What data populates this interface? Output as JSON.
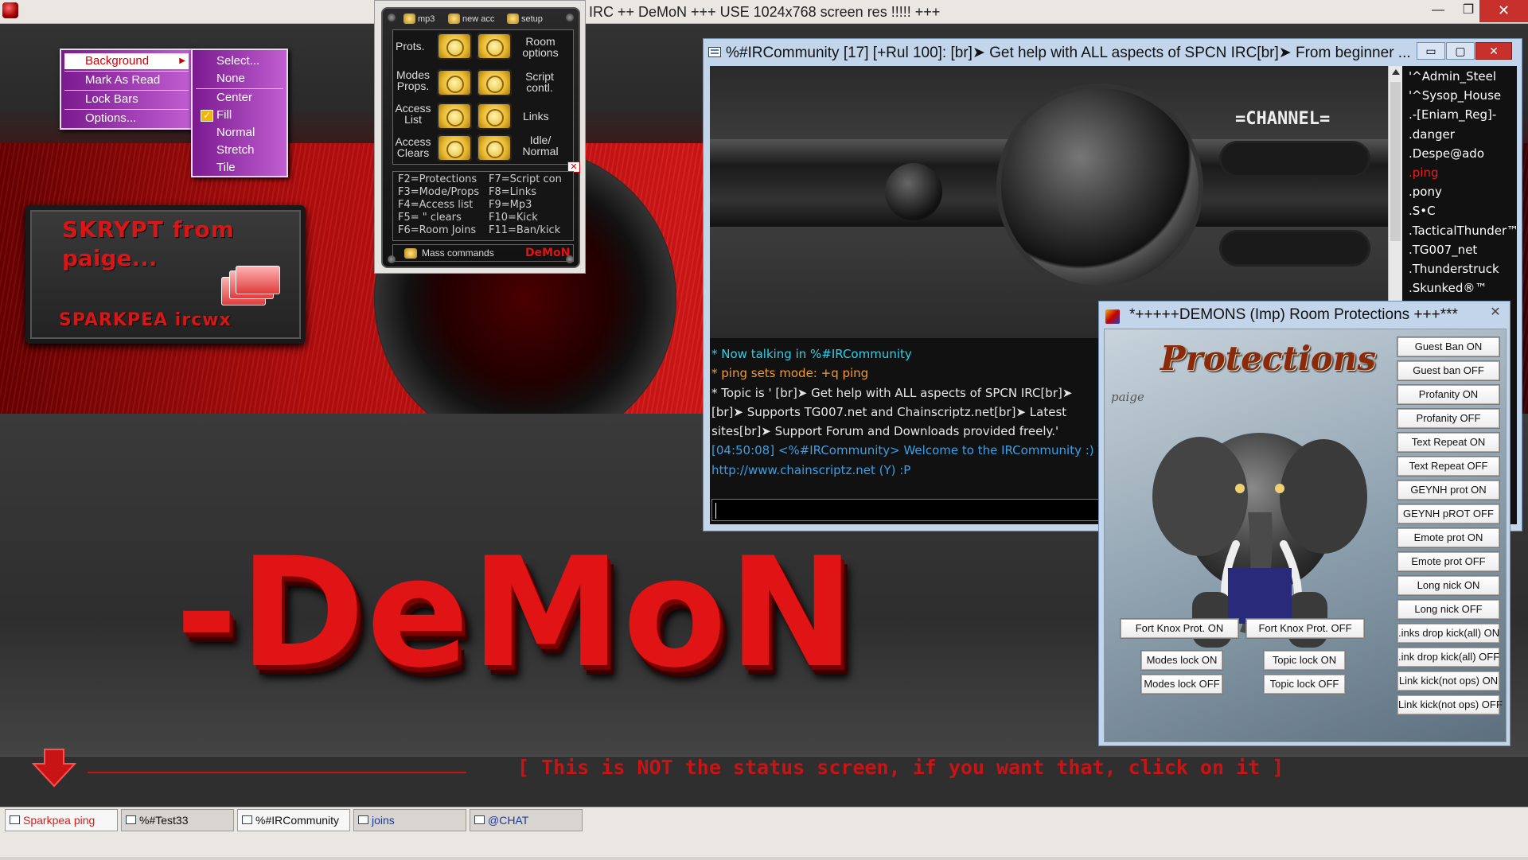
{
  "app": {
    "title": "IRC ++ DeMoN +++ USE 1024x768 screen res !!!!! +++",
    "controls": {
      "minimize": "—",
      "maximize": "❐",
      "close": "✕"
    }
  },
  "background": {
    "skrypt_line1": "SKRYPT from",
    "skrypt_line2": "paige...",
    "skrypt_line3": "SPARKPEA  ircwx",
    "big_logo": "-DeMoN",
    "status_notice": "[ This is NOT the status screen, if you want that, click on it ]",
    "accent_color": "#d81616"
  },
  "context_menu": {
    "items": [
      "Background",
      "Mark As Read",
      "Lock Bars",
      "Options..."
    ],
    "submenu": [
      "Select...",
      "None",
      "Center",
      "Fill",
      "Normal",
      "Stretch",
      "Tile"
    ],
    "checked": "Fill"
  },
  "control_panel": {
    "tabs": [
      "mp3",
      "new acc",
      "setup"
    ],
    "buttons": [
      {
        "label": "Prots."
      },
      {
        "label": "Room options"
      },
      {
        "label": "Modes Props."
      },
      {
        "label": "Script contl."
      },
      {
        "label": "Access List"
      },
      {
        "label": "Links"
      },
      {
        "label": "Access Clears"
      },
      {
        "label": "Idle/ Normal"
      }
    ],
    "keys_left": [
      "F2=Protections",
      "F3=Mode/Props",
      "F4=Access list",
      "F5= \" clears",
      "F6=Room Joins"
    ],
    "keys_right": [
      "F7=Script con",
      "F8=Links",
      "F9=Mp3",
      "F10=Kick",
      "F11=Ban/kick"
    ],
    "mass_label": "Mass commands",
    "brand": "DeMoN"
  },
  "channel": {
    "title": "%#IRCommunity [17] [+Rul 100]:  [br]➤ Get help with ALL aspects of SPCN IRC[br]➤ From beginner ...",
    "art_label": "=CHANNEL=",
    "lines": [
      {
        "text": "* Now talking in %#IRCommunity",
        "color": "#2fd0e8"
      },
      {
        "text": "* ping sets mode: +q ping",
        "color": "#f39a2a"
      },
      {
        "text": "* Topic is ' [br]➤ Get help with ALL aspects of SPCN IRC[br]➤",
        "color": "#e6e6e6"
      },
      {
        "text": "  [br]➤ Supports TG007.net and Chainscriptz.net[br]➤ Latest",
        "color": "#e6e6e6"
      },
      {
        "text": "  sites[br]➤ Support Forum and Downloads provided freely.'",
        "color": "#e6e6e6"
      },
      {
        "text": "[04:50:08] <%#IRCommunity> Welcome to the IRCommunity :) You",
        "color": "#3aa0e8"
      },
      {
        "text": "http://www.chainscriptz.net (Y) :P",
        "color": "#3aa0e8"
      }
    ],
    "nicks": [
      {
        "name": "'^Admin_Steel",
        "color": "#ffffff"
      },
      {
        "name": "'^Sysop_House",
        "color": "#ffffff"
      },
      {
        "name": ".-[Eniam_Reg]-",
        "color": "#ffffff"
      },
      {
        "name": ".danger",
        "color": "#ffffff"
      },
      {
        "name": ".Despe@ado",
        "color": "#ffffff"
      },
      {
        "name": ".ping",
        "color": "#e02020"
      },
      {
        "name": ".pony",
        "color": "#ffffff"
      },
      {
        "name": ".S•C",
        "color": "#ffffff"
      },
      {
        "name": ".TacticalThunder™",
        "color": "#ffffff"
      },
      {
        "name": ".TG007_net",
        "color": "#ffffff"
      },
      {
        "name": ".Thunderstruck",
        "color": "#ffffff"
      },
      {
        "name": ".Skunked®™",
        "color": "#ffffff"
      }
    ]
  },
  "protections": {
    "title": "*+++++DEMONS (Imp) Room Protections +++***",
    "heading": "Protections",
    "author": "paige",
    "right_buttons": [
      "Guest Ban ON",
      "Guest ban OFF",
      "Profanity ON",
      "Profanity OFF",
      "Text Repeat ON",
      "Text Repeat OFF",
      "GEYNH prot ON",
      "GEYNH pROT OFF",
      "Emote prot ON",
      "Emote prot OFF",
      "Long nick ON",
      "Long nick OFF",
      ".inks drop kick(all) ON",
      ".ink drop kick(all) OFF",
      "Link kick(not ops) ON",
      "Link kick(not ops) OFF"
    ],
    "fortknox_on": "Fort Knox Prot. ON",
    "fortknox_off": "Fort Knox Prot. OFF",
    "modes_on": "Modes lock ON",
    "modes_off": "Modes lock OFF",
    "topic_on": "Topic lock ON",
    "topic_off": "Topic lock OFF"
  },
  "taskbar": {
    "tabs": [
      {
        "label": "Sparkpea ping",
        "color": "#e01818",
        "active": true
      },
      {
        "label": "%#Test33",
        "color": "#111111",
        "active": false
      },
      {
        "label": "%#IRCommunity",
        "color": "#111111",
        "active": true
      },
      {
        "label": "joins",
        "color": "#1a3aa0",
        "active": false
      },
      {
        "label": "@CHAT",
        "color": "#1a3aa0",
        "active": false
      }
    ]
  }
}
